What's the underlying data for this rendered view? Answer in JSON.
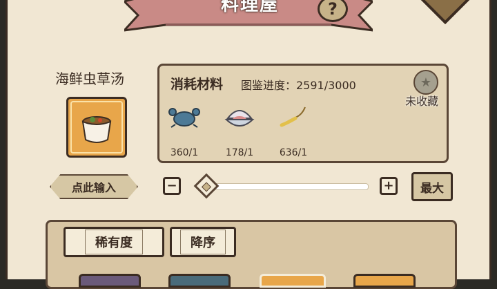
{
  "header": {
    "title": "料理屋",
    "help_label": "?"
  },
  "recipe": {
    "name": "海鲜虫草汤",
    "icon": "soup-pot-icon"
  },
  "materials": {
    "title": "消耗材料",
    "progress_text": "图鉴进度：2591/3000",
    "collect_status": "未收藏",
    "items": [
      {
        "icon": "crab-icon",
        "count": "360/1"
      },
      {
        "icon": "clam-icon",
        "count": "178/1"
      },
      {
        "icon": "cordyceps-icon",
        "count": "636/1"
      }
    ]
  },
  "quantity": {
    "input_label": "点此输入",
    "minus_label": "−",
    "plus_label": "+",
    "max_label": "最大",
    "slider_value": 0
  },
  "sort": {
    "rarity_label": "稀有度",
    "order_label": "降序"
  },
  "colors": {
    "panel_bg": "#f1e7d3",
    "banner": "#c98a86",
    "slot_orange": "#e8a64a",
    "outline": "#3b2c22"
  }
}
